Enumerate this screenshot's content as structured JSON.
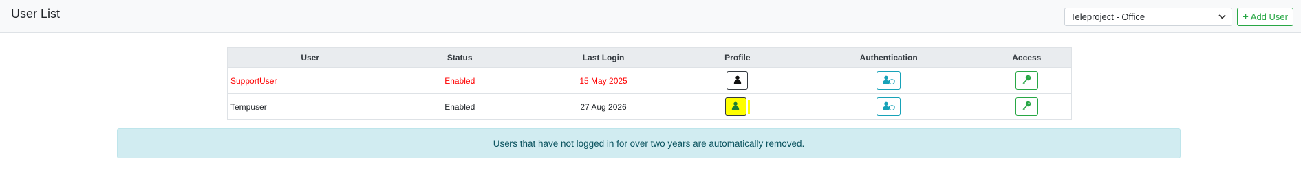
{
  "header": {
    "title": "User List",
    "office_select": {
      "selected": "Teleproject - Office"
    },
    "add_user_label": "Add User"
  },
  "table": {
    "columns": [
      "User",
      "Status",
      "Last Login",
      "Profile",
      "Authentication",
      "Access"
    ],
    "rows": [
      {
        "user": "SupportUser",
        "status": "Enabled",
        "last_login": "15 May 2025",
        "highlight_color": "#ff0000",
        "profile_highlighted": false
      },
      {
        "user": "Tempuser",
        "status": "Enabled",
        "last_login": "27 Aug 2026",
        "highlight_color": "#212529",
        "profile_highlighted": true
      }
    ]
  },
  "notice": "Users that have not logged in for over two years are automatically removed.",
  "colors": {
    "success": "#28a745",
    "info": "#17a2b8",
    "danger": "#ff0000",
    "highlight": "#ffff00",
    "alert_bg": "#d1ecf1"
  },
  "icons": {
    "profile": "user-icon",
    "authentication": "user-shield-icon",
    "access": "key-icon",
    "select_arrow": "chevron-down-icon",
    "add": "plus-icon"
  }
}
